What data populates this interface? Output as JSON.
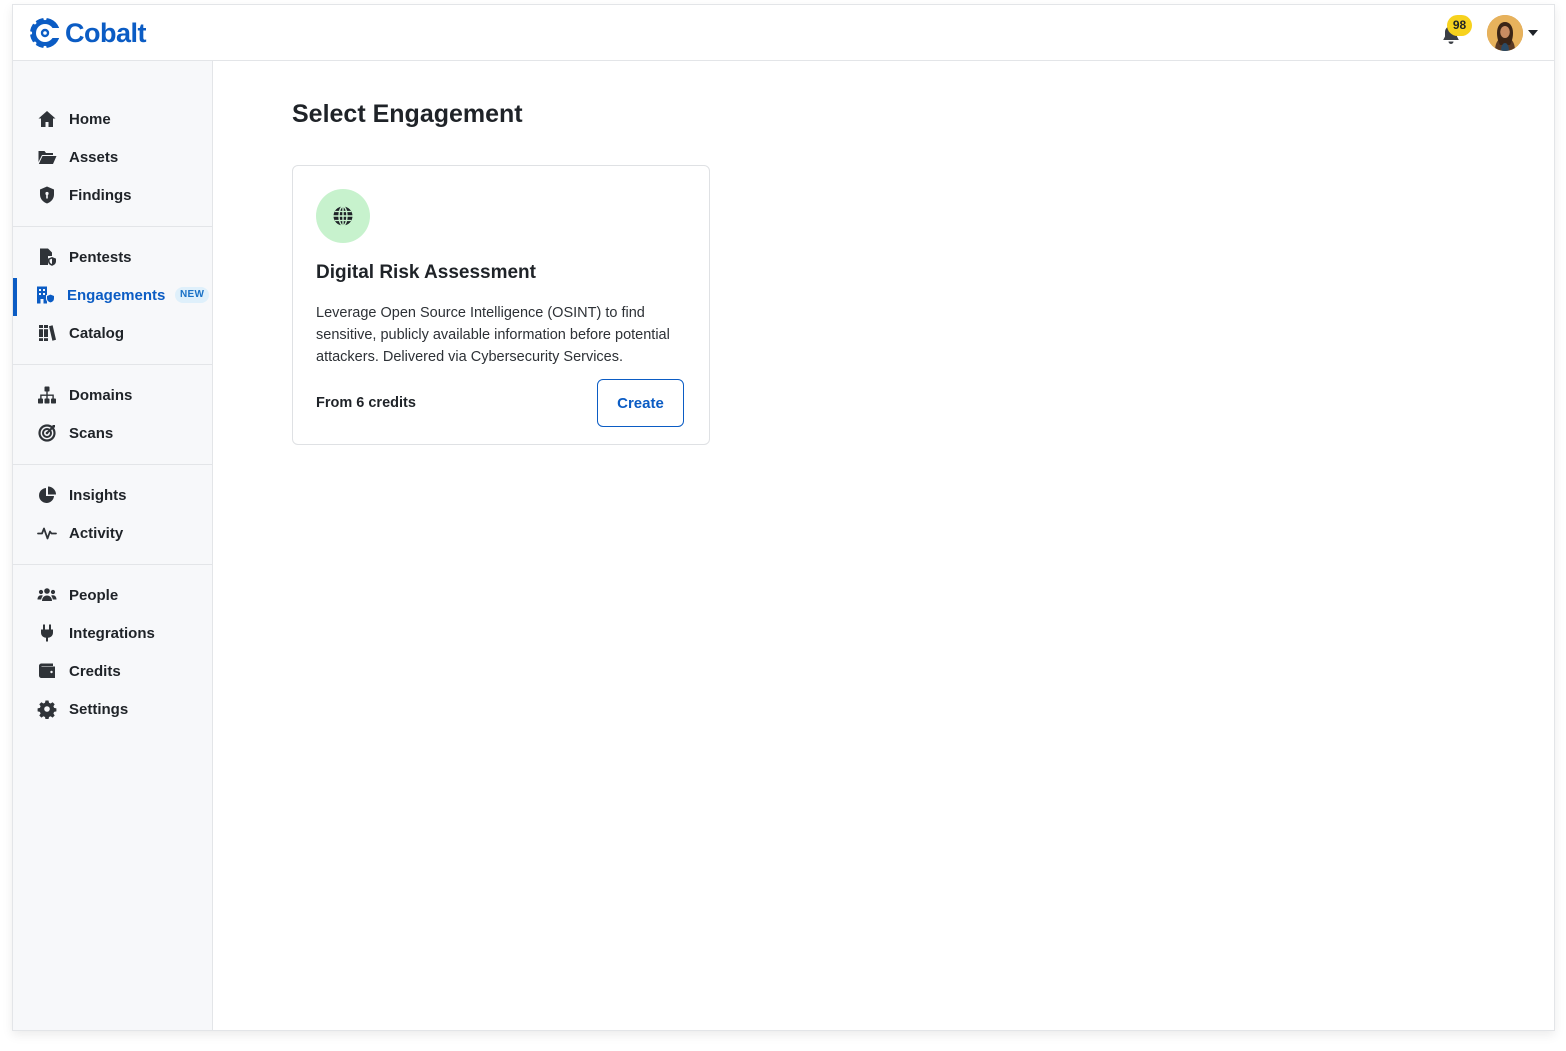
{
  "app": {
    "brand": "Cobalt",
    "brand_color": "#0b5cc4"
  },
  "header": {
    "notification_count": "98",
    "notification_icon": "bell-icon",
    "avatar_icon": "user-avatar"
  },
  "sidebar": {
    "groups": [
      {
        "items": [
          {
            "label": "Home",
            "icon": "home-icon"
          },
          {
            "label": "Assets",
            "icon": "folder-open-icon"
          },
          {
            "label": "Findings",
            "icon": "shield-icon"
          }
        ]
      },
      {
        "items": [
          {
            "label": "Pentests",
            "icon": "file-shield-icon"
          },
          {
            "label": "Engagements",
            "icon": "building-shield-icon",
            "badge": "NEW",
            "active": true
          },
          {
            "label": "Catalog",
            "icon": "books-icon"
          }
        ]
      },
      {
        "items": [
          {
            "label": "Domains",
            "icon": "sitemap-icon"
          },
          {
            "label": "Scans",
            "icon": "bullseye-icon"
          }
        ]
      },
      {
        "items": [
          {
            "label": "Insights",
            "icon": "pie-chart-icon"
          },
          {
            "label": "Activity",
            "icon": "pulse-icon"
          }
        ]
      },
      {
        "items": [
          {
            "label": "People",
            "icon": "people-icon"
          },
          {
            "label": "Integrations",
            "icon": "plug-icon"
          },
          {
            "label": "Credits",
            "icon": "wallet-icon"
          },
          {
            "label": "Settings",
            "icon": "gear-icon"
          }
        ]
      }
    ]
  },
  "main": {
    "title": "Select Engagement",
    "card": {
      "icon": "globe-icon",
      "icon_bg": "#c7f2cd",
      "title": "Digital Risk Assessment",
      "description": "Leverage Open Source Intelligence (OSINT) to find sensitive, publicly available information before potential attackers. Delivered via Cybersecurity Services.",
      "price": "From 6 credits",
      "button_label": "Create"
    }
  }
}
